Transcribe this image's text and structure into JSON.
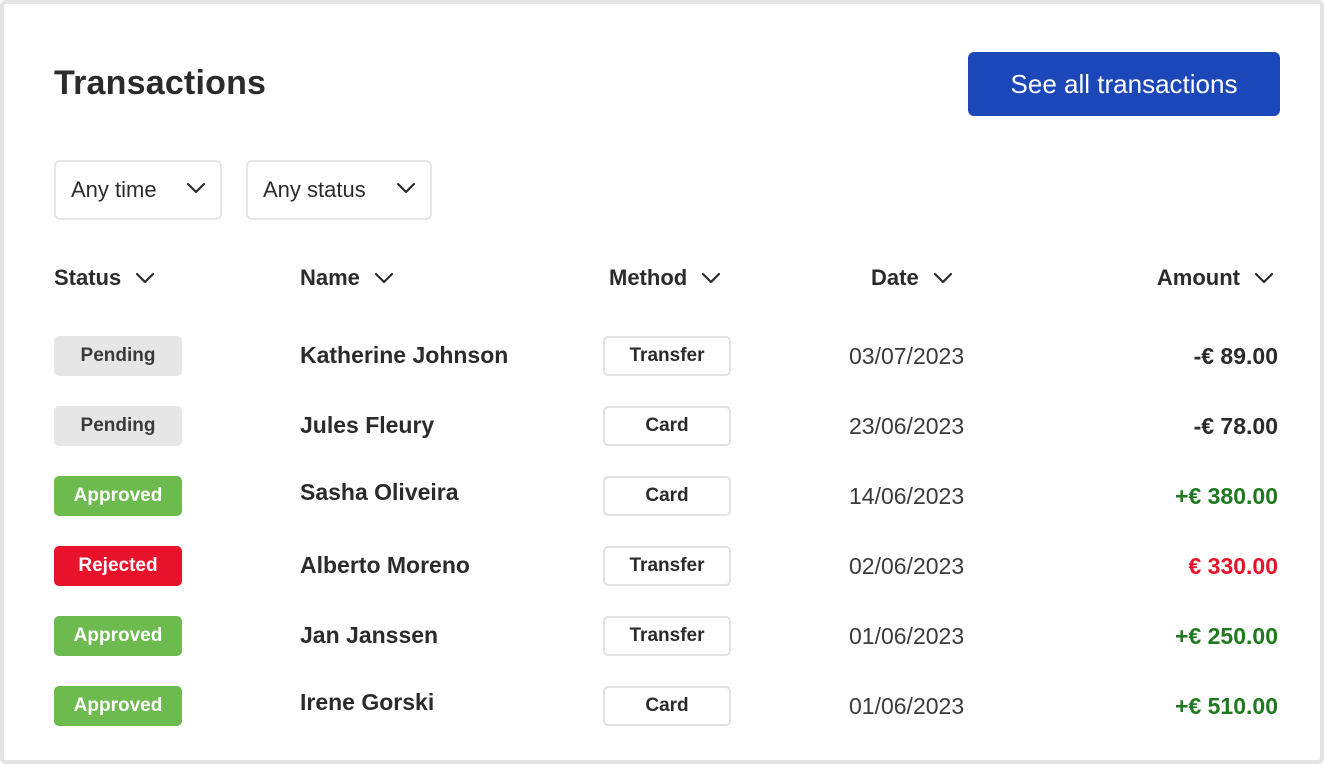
{
  "header": {
    "title": "Transactions",
    "see_all_label": "See all transactions",
    "button_color": "#1c47b8"
  },
  "filters": {
    "time": {
      "selected": "Any time",
      "icon": "chevron-down-icon"
    },
    "status": {
      "selected": "Any status",
      "icon": "chevron-down-icon"
    }
  },
  "table": {
    "columns": [
      {
        "label": "Status"
      },
      {
        "label": "Name"
      },
      {
        "label": "Method"
      },
      {
        "label": "Date"
      },
      {
        "label": "Amount"
      }
    ],
    "rows": [
      {
        "status": "Pending",
        "status_kind": "pending",
        "name": "Katherine Johnson",
        "method": "Transfer",
        "date": "03/07/2023",
        "amount": "-€ 89.00",
        "amount_kind": "neutral"
      },
      {
        "status": "Pending",
        "status_kind": "pending",
        "name": "Jules Fleury",
        "method": "Card",
        "date": "23/06/2023",
        "amount": "-€ 78.00",
        "amount_kind": "neutral"
      },
      {
        "status": "Approved",
        "status_kind": "approved",
        "name": "Sasha Oliveira",
        "method": "Card",
        "date": "14/06/2023",
        "amount": "+€ 380.00",
        "amount_kind": "positive"
      },
      {
        "status": "Rejected",
        "status_kind": "rejected",
        "name": "Alberto Moreno",
        "method": "Transfer",
        "date": "02/06/2023",
        "amount": "€ 330.00",
        "amount_kind": "negative"
      },
      {
        "status": "Approved",
        "status_kind": "approved",
        "name": "Jan Janssen",
        "method": "Transfer",
        "date": "01/06/2023",
        "amount": "+€ 250.00",
        "amount_kind": "positive"
      },
      {
        "status": "Approved",
        "status_kind": "approved",
        "name": "Irene Gorski",
        "method": "Card",
        "date": "01/06/2023",
        "amount": "+€ 510.00",
        "amount_kind": "positive"
      }
    ]
  },
  "colors": {
    "pending": "#e6e6e6",
    "approved": "#6dbb4f",
    "rejected": "#e8132a",
    "positive_amount": "#1f7a1f",
    "negative_amount": "#e8132a"
  }
}
